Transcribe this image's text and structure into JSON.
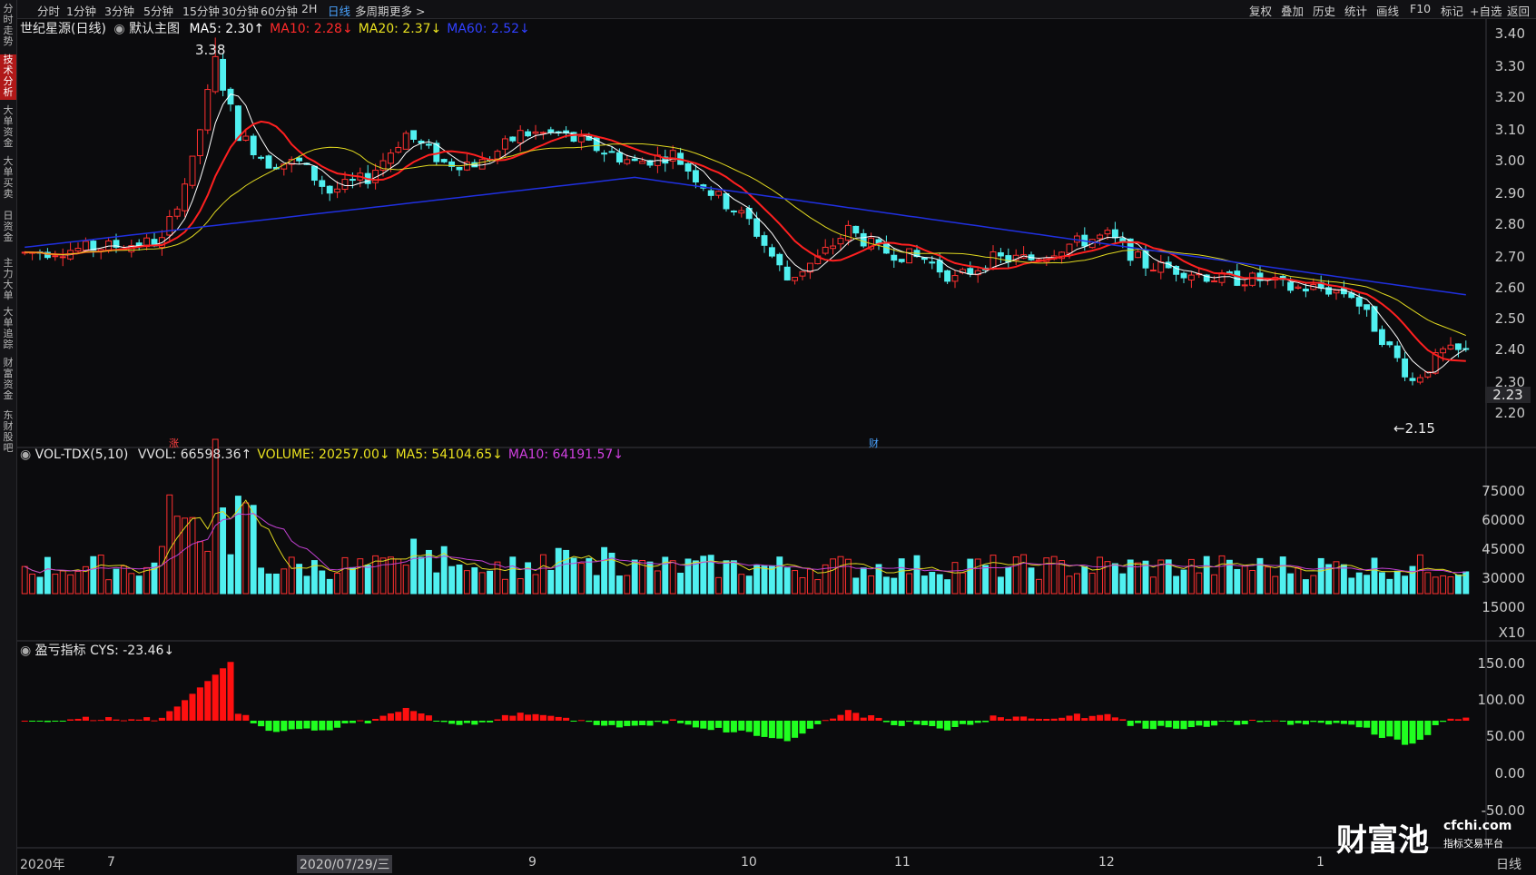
{
  "sidebar": {
    "items": [
      {
        "label": "分时走势",
        "active": false
      },
      {
        "label": "技术分析",
        "active": true
      },
      {
        "label": "大单资金",
        "active": false
      },
      {
        "label": "大单买卖",
        "active": false
      },
      {
        "label": "日资金",
        "active": false
      },
      {
        "label": "主力大单",
        "active": false
      },
      {
        "label": "大单追踪",
        "active": false
      },
      {
        "label": "财富资金",
        "active": false
      },
      {
        "label": "东财股吧",
        "active": false
      }
    ]
  },
  "toolbar": {
    "periods": [
      {
        "label": "分时",
        "active": false
      },
      {
        "label": "1分钟",
        "active": false
      },
      {
        "label": "3分钟",
        "active": false
      },
      {
        "label": "5分钟",
        "active": false
      },
      {
        "label": "15分钟",
        "active": false
      },
      {
        "label": "30分钟",
        "active": false
      },
      {
        "label": "60分钟",
        "active": false
      },
      {
        "label": "2H",
        "active": false
      },
      {
        "label": "日线",
        "active": true
      },
      {
        "label": "多周期",
        "active": false
      },
      {
        "label": "更多 >",
        "active": false
      }
    ],
    "right": [
      "复权",
      "叠加",
      "历史",
      "统计",
      "画线",
      "F10",
      "标记",
      "+自选",
      "返回"
    ]
  },
  "main_panel": {
    "title": "世纪星源(日线)",
    "indicator": "默认主图",
    "ma": [
      {
        "text": "MA5: 2.30↑",
        "color": "#ffffff"
      },
      {
        "text": "MA10: 2.28↓",
        "color": "#ff2a2a"
      },
      {
        "text": "MA20: 2.37↓",
        "color": "#e8e020"
      },
      {
        "text": "MA60: 2.52↓",
        "color": "#3040ff"
      }
    ],
    "high_label": "3.38",
    "low_label": "←2.15",
    "current_price": "2.23",
    "axis": [
      "3.40",
      "3.30",
      "3.20",
      "3.10",
      "3.00",
      "2.90",
      "2.80",
      "2.70",
      "2.60",
      "2.50",
      "2.40",
      "2.30",
      "2.20"
    ],
    "markers": {
      "rise": "涨",
      "finance": "财"
    }
  },
  "vol_panel": {
    "title": "VOL-TDX(5,10)",
    "items": [
      {
        "text": "VVOL: 66598.36↑",
        "color": "#e0e0e0"
      },
      {
        "text": "VOLUME: 20257.00↓",
        "color": "#e8e020"
      },
      {
        "text": "MA5: 54104.65↓",
        "color": "#e8e020"
      },
      {
        "text": "MA10: 64191.57↓",
        "color": "#d040e0"
      }
    ],
    "axis": [
      "75000",
      "60000",
      "45000",
      "30000",
      "15000",
      "X10"
    ]
  },
  "cys_panel": {
    "title": "盈亏指标",
    "value_text": "CYS: -23.46↓",
    "axis": [
      "150.00",
      "100.00",
      "50.00",
      "0.00",
      "-50.00"
    ]
  },
  "x_axis": {
    "labels": [
      "2020年",
      "7",
      "2020/07/29/三",
      "9",
      "10",
      "11",
      "12",
      "1",
      "日线"
    ]
  },
  "watermark": {
    "brand": "财富池",
    "site": "cfchi.com",
    "slogan": "指标交易平台"
  },
  "colors": {
    "up": "#ff3030",
    "down": "#50f0f0",
    "ma5": "#ffffff",
    "ma10": "#ff2020",
    "ma20": "#e0d820",
    "ma60": "#2030e0",
    "vol_ma5": "#e0d820",
    "vol_ma10": "#c040d0",
    "cys_pos": "#ff1010",
    "cys_neg": "#20ff20",
    "cys_neg_deep": "#10b8c8"
  }
}
